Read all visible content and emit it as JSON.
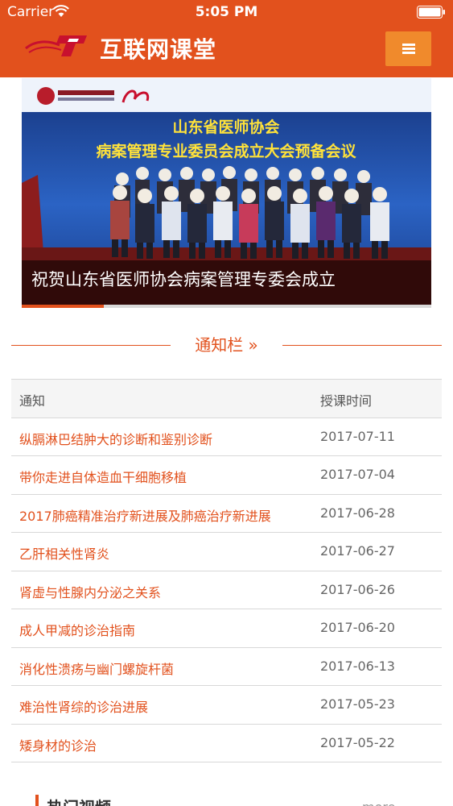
{
  "status_bar": {
    "carrier": "Carrier",
    "time": "5:05 PM"
  },
  "app": {
    "title": "互联网课堂",
    "accent": "#e2511d",
    "menu_color": "#f08a2c"
  },
  "banner": {
    "heading_line1": "山东省医师协会",
    "heading_line2": "病案管理专业委员会成立大会预备会议",
    "caption": "祝贺山东省医师协会病案管理专委会成立",
    "slide_progress": 0.2
  },
  "notice_section": {
    "title": "通知栏 »"
  },
  "notice_table": {
    "headers": {
      "title": "通知",
      "date": "授课时间"
    },
    "rows": [
      {
        "title": "纵膈淋巴结肿大的诊断和鉴别诊断",
        "date": "2017-07-11"
      },
      {
        "title": "带你走进自体造血干细胞移植",
        "date": "2017-07-04"
      },
      {
        "title": "2017肺癌精准治疗新进展及肺癌治疗新进展",
        "date": "2017-06-28"
      },
      {
        "title": "乙肝相关性肾炎",
        "date": "2017-06-27"
      },
      {
        "title": "肾虚与性腺内分泌之关系",
        "date": "2017-06-26"
      },
      {
        "title": "成人甲减的诊治指南",
        "date": "2017-06-20"
      },
      {
        "title": "消化性溃疡与幽门螺旋杆菌",
        "date": "2017-06-13"
      },
      {
        "title": "难治性肾综的诊治进展",
        "date": "2017-05-23"
      },
      {
        "title": "矮身材的诊治",
        "date": "2017-05-22"
      }
    ]
  },
  "hot_videos": {
    "title": "热门视频",
    "more": "more"
  }
}
